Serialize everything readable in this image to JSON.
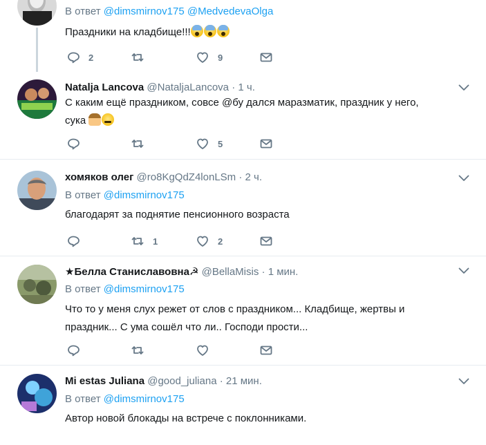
{
  "tweets": [
    {
      "reply_prefix": "В ответ",
      "mentions": [
        "@dimsmirnov175",
        "@MedvedevaOlga"
      ],
      "text": "Праздники на кладбище!!!",
      "emojis": [
        "face-screaming-in-fear",
        "face-screaming-in-fear",
        "face-screaming-in-fear"
      ],
      "reply_count": "2",
      "retweet_count": "",
      "like_count": "9"
    },
    {
      "name": "Natalja Lancova",
      "handle": "@NataljaLancova",
      "dot": "·",
      "time": "1 ч.",
      "text_line1": "С каким ещё праздником, совсе @бу дался маразматик, праздник у него,",
      "text_line2": "сука",
      "emojis": [
        "woman-facepalming",
        "persevering-face"
      ],
      "reply_count": "",
      "retweet_count": "",
      "like_count": "5"
    },
    {
      "name": "хомяков олег",
      "handle": "@ro8KgQdZ4lonLSm",
      "dot": "·",
      "time": "2 ч.",
      "reply_prefix": "В ответ",
      "mention": "@dimsmirnov175",
      "text": "благодарят за поднятие пенсионного возраста",
      "reply_count": "",
      "retweet_count": "1",
      "like_count": "2"
    },
    {
      "name": "★Белла Станиславовна☭",
      "handle": "@BellaMisis",
      "dot": "·",
      "time": "1 мин.",
      "reply_prefix": "В ответ",
      "mention": "@dimsmirnov175",
      "text_line1": "Что то у меня слух режет от слов с праздником... Кладбище, жертвы и",
      "text_line2": "праздник... С ума сошёл что ли.. Господи прости...",
      "reply_count": "",
      "retweet_count": "",
      "like_count": ""
    },
    {
      "name": "Mi estas Juliana",
      "handle": "@good_juliana",
      "dot": "·",
      "time": "21 мин.",
      "reply_prefix": "В ответ",
      "mention": "@dimsmirnov175",
      "text": "Автор новой блокады на встрече с поклонниками."
    }
  ],
  "icons": {
    "reply": "reply-icon",
    "retweet": "retweet-icon",
    "like": "heart-icon",
    "dm": "envelope-icon",
    "more": "chevron-down-icon"
  },
  "colors": {
    "link": "#1da1f2",
    "muted": "#657786",
    "text": "#14171a",
    "separator": "#e6ecf0"
  }
}
